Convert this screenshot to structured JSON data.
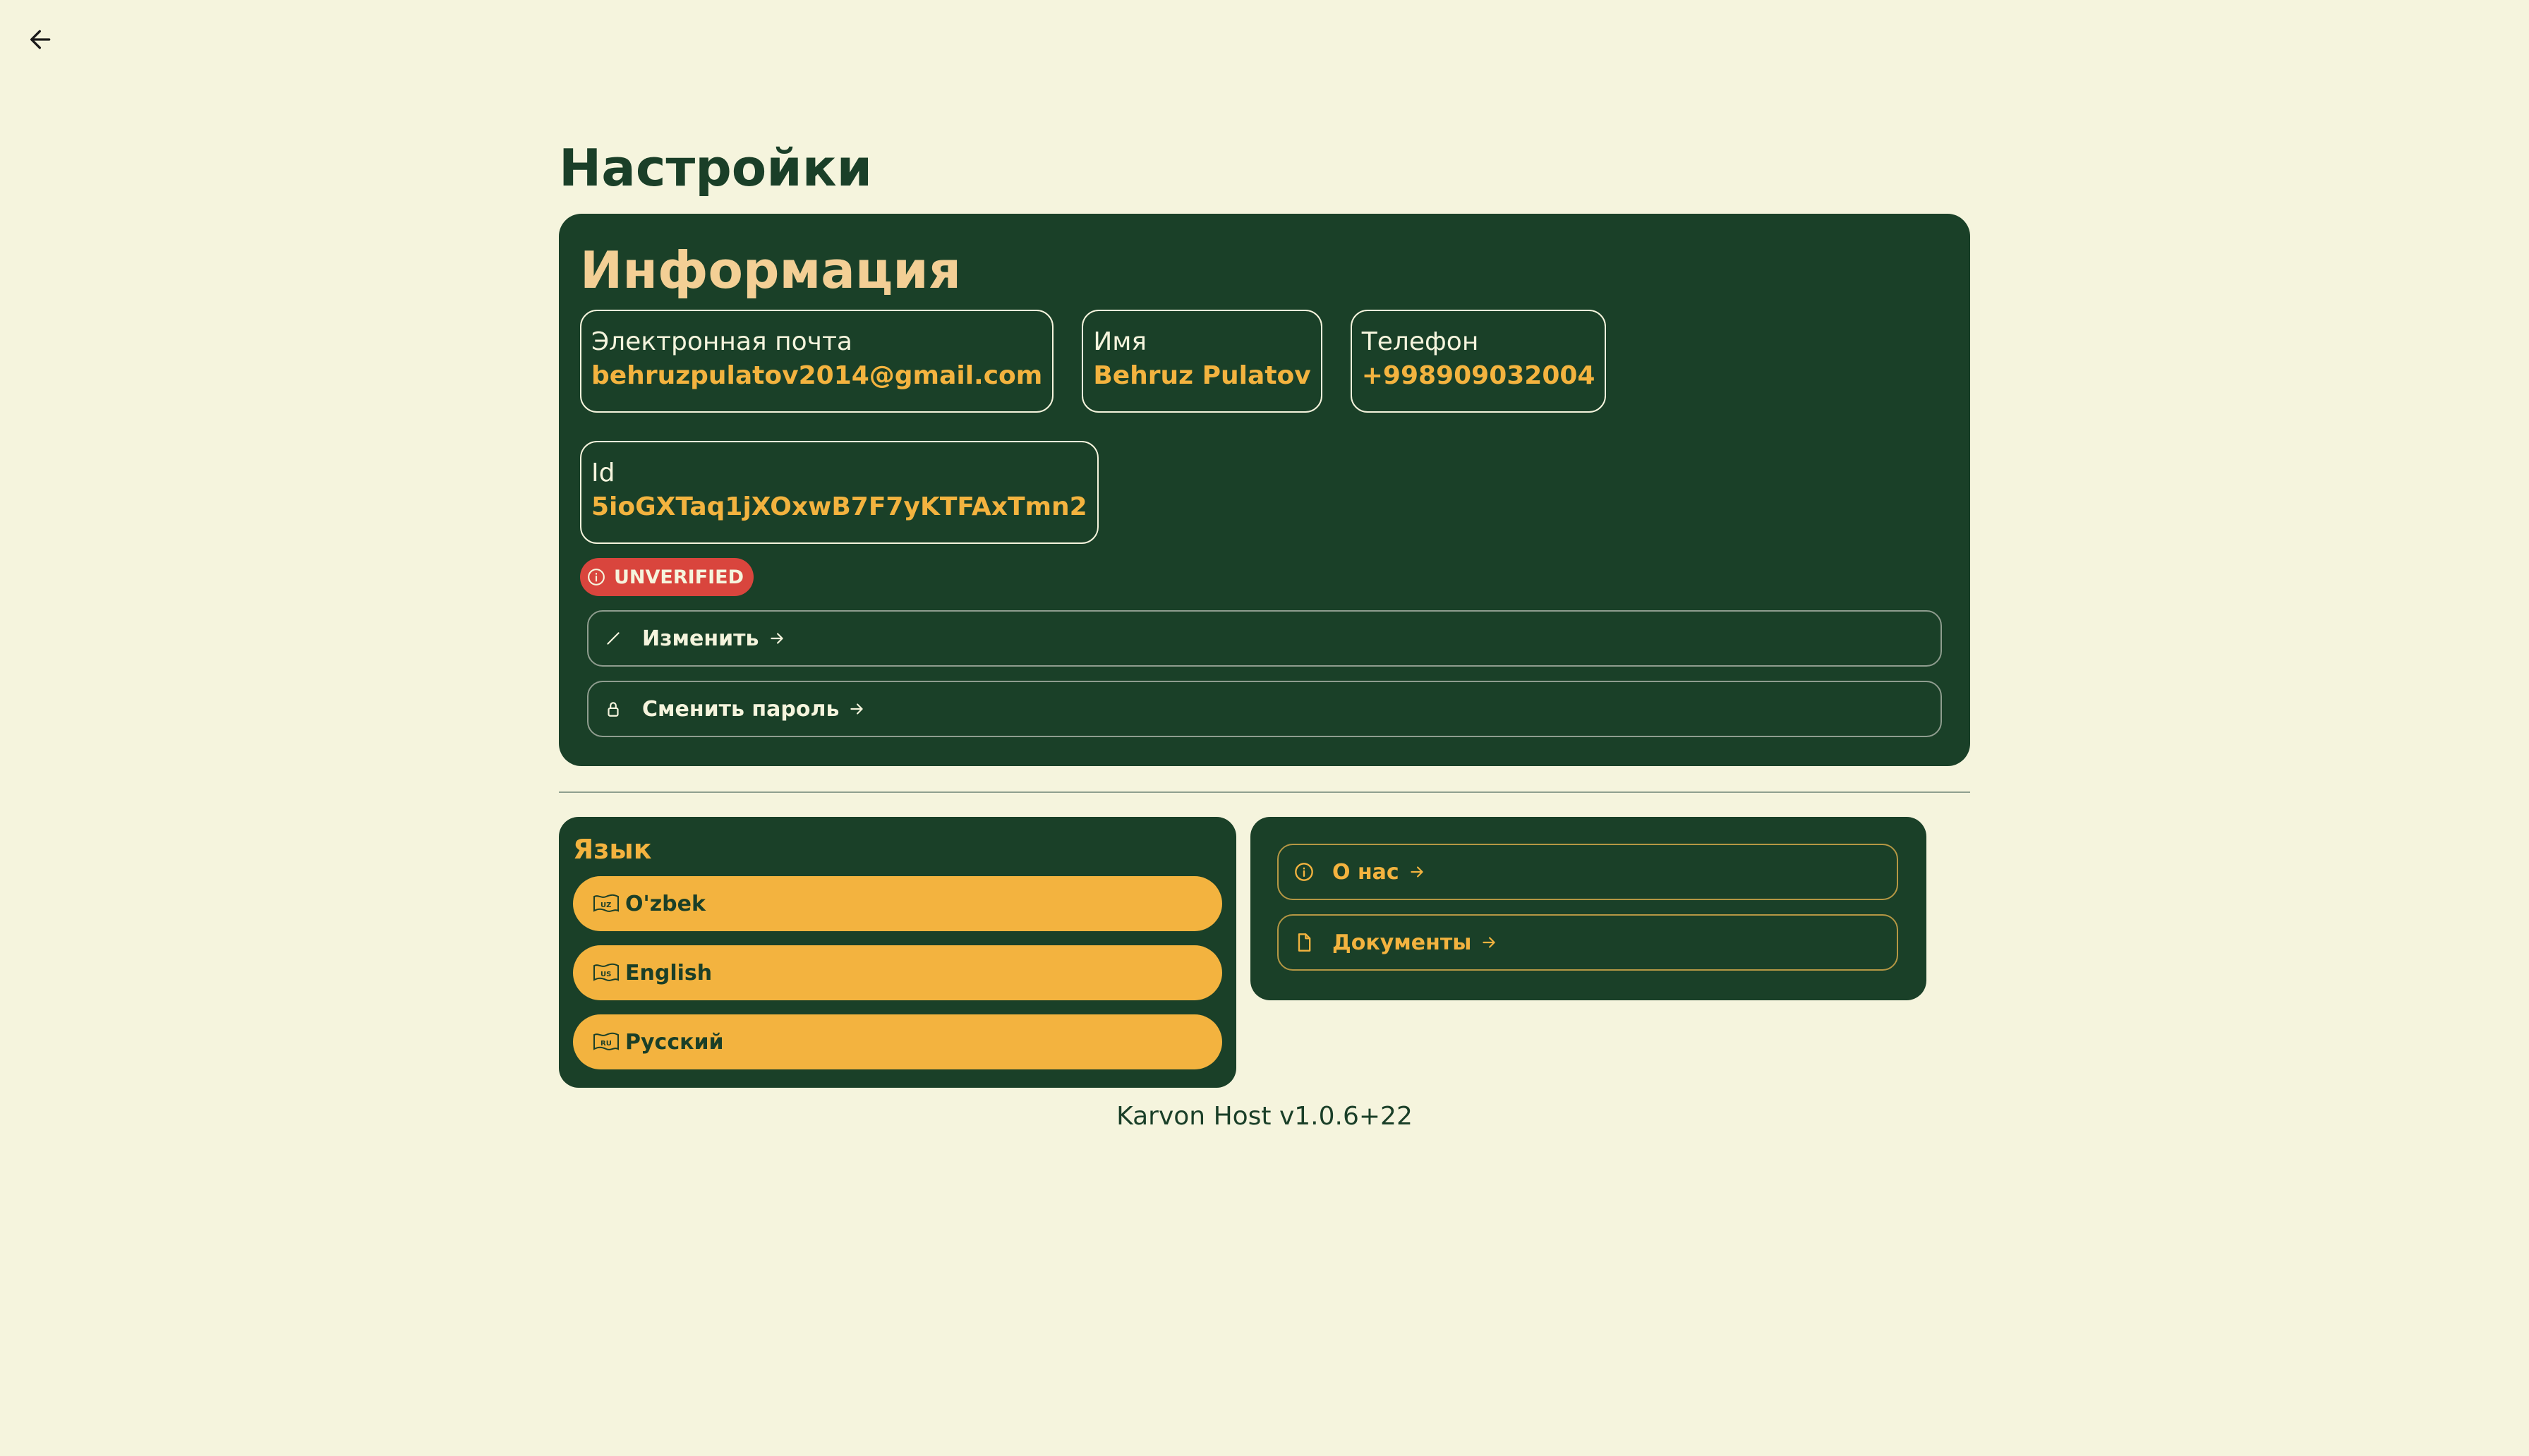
{
  "header": {
    "back_icon": "arrow-left-icon"
  },
  "page": {
    "title": "Настройки"
  },
  "info": {
    "title": "Информация",
    "fields": [
      {
        "label": "Электронная почта",
        "value": "behruzpulatov2014@gmail.com"
      },
      {
        "label": "Имя",
        "value": "Behruz Pulatov"
      },
      {
        "label": "Телефон",
        "value": "+998909032004"
      },
      {
        "label": "Id",
        "value": "5ioGXTaq1jXOxwB7F7yKTFAxTmn2"
      }
    ],
    "badge": {
      "label": "UNVERIFIED",
      "icon": "info-icon",
      "color": "#d9453d"
    },
    "actions": [
      {
        "label": "Изменить",
        "icon": "pencil-icon"
      },
      {
        "label": "Сменить пароль",
        "icon": "lock-icon"
      }
    ]
  },
  "language": {
    "title": "Язык",
    "options": [
      {
        "label": "O'zbek",
        "icon": "flag-uz-icon"
      },
      {
        "label": "English",
        "icon": "flag-en-icon"
      },
      {
        "label": "Русский",
        "icon": "flag-ru-icon"
      }
    ]
  },
  "links": [
    {
      "label": "О нас",
      "icon": "info-icon"
    },
    {
      "label": "Документы",
      "icon": "document-icon"
    }
  ],
  "footer": {
    "version": "Karvon Host v1.0.6+22"
  },
  "colors": {
    "background": "#f5f4dd",
    "card": "#1a4028",
    "accent": "#f3b33f",
    "title_accent": "#f3cf95",
    "danger": "#d9453d"
  }
}
